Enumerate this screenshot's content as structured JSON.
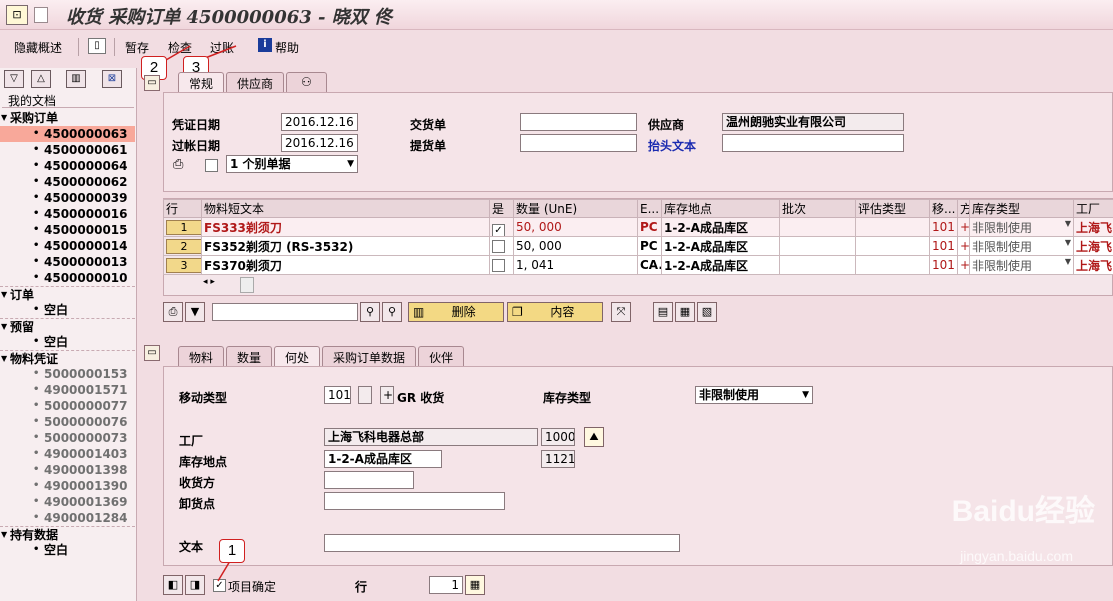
{
  "title": {
    "icon": "⊡",
    "text": "收货 采购订单 4500000063 - 晓双 佟"
  },
  "toolbar": {
    "hide_overview": "隐藏概述",
    "hold": "暂存",
    "check": "检查",
    "post": "过账",
    "help": "帮助"
  },
  "callouts": {
    "c1": "1",
    "c2": "2",
    "c3": "3"
  },
  "tree": {
    "header": "我的文档",
    "groups": [
      {
        "label": "采购订单",
        "items": [
          "4500000063",
          "4500000061",
          "4500000064",
          "4500000062",
          "4500000039",
          "4500000016",
          "4500000015",
          "4500000014",
          "4500000013",
          "4500000010"
        ]
      },
      {
        "label": "订单",
        "items": [
          "空白"
        ]
      },
      {
        "label": "预留",
        "items": [
          "空白"
        ]
      },
      {
        "label": "物料凭证",
        "items": [
          "5000000153",
          "4900001571",
          "5000000077",
          "5000000076",
          "5000000073",
          "4900001403",
          "4900001398",
          "4900001390",
          "4900001369",
          "4900001284"
        ]
      },
      {
        "label": "持有数据",
        "items": [
          "空白"
        ]
      }
    ]
  },
  "header_tabs": [
    "常规",
    "供应商"
  ],
  "header": {
    "doc_date_label": "凭证日期",
    "doc_date": "2016.12.16",
    "post_date_label": "过帐日期",
    "post_date": "2016.12.16",
    "delivery_note_label": "交货单",
    "delivery_note": "",
    "bill_of_lading_label": "提货单",
    "bill_of_lading": "",
    "vendor_label": "供应商",
    "vendor": "温州朗驰实业有限公司",
    "header_text_link": "抬头文本",
    "header_text": "",
    "slip_option": "1 个别单据"
  },
  "grid": {
    "columns": [
      "行",
      "物料短文本",
      "是",
      "数量 (UnE)",
      "E...",
      "库存地点",
      "批次",
      "评估类型",
      "移...",
      "方",
      "库存类型",
      "工厂"
    ],
    "rows": [
      {
        "line": "1",
        "material": "FS333剃须刀",
        "ok": "✓",
        "qty": "50, 000",
        "unit": "PC",
        "sloc": "1-2-A成品库区",
        "batch": "",
        "val": "",
        "mvt": "101",
        "dir": "+",
        "stype": "非限制使用",
        "plant": "上海飞"
      },
      {
        "line": "2",
        "material": "FS352剃须刀 (RS-3532)",
        "ok": "",
        "qty": "50, 000",
        "unit": "PC",
        "sloc": "1-2-A成品库区",
        "batch": "",
        "val": "",
        "mvt": "101",
        "dir": "+",
        "stype": "非限制使用",
        "plant": "上海飞"
      },
      {
        "line": "3",
        "material": "FS370剃须刀",
        "ok": "",
        "qty": "1, 041",
        "unit": "CA...",
        "sloc": "1-2-A成品库区",
        "batch": "",
        "val": "",
        "mvt": "101",
        "dir": "+",
        "stype": "非限制使用",
        "plant": "上海飞"
      }
    ]
  },
  "grid_toolbar": {
    "delete": "删除",
    "content": "内容",
    "search_value": ""
  },
  "detail_tabs": [
    "物料",
    "数量",
    "何处",
    "采购订单数据",
    "伙伴"
  ],
  "detail": {
    "mvt_type_label": "移动类型",
    "mvt_type": "101",
    "mvt_plus": "+",
    "mvt_desc": "GR 收货",
    "stock_type_label": "库存类型",
    "stock_type": "非限制使用",
    "plant_label": "工厂",
    "plant": "上海飞科电器总部",
    "plant_code": "1000",
    "sloc_label": "库存地点",
    "sloc": "1-2-A成品库区",
    "sloc_code": "1121",
    "recipient_label": "收货方",
    "recipient": "",
    "unloading_label": "卸货点",
    "unloading": "",
    "text_label": "文本",
    "text": ""
  },
  "footer": {
    "item_ok_label": "项目确定",
    "item_ok": "✓",
    "line_label": "行",
    "line_value": "1"
  },
  "watermark": {
    "brand": "Baidu经验",
    "url": "jingyan.baidu.com"
  }
}
